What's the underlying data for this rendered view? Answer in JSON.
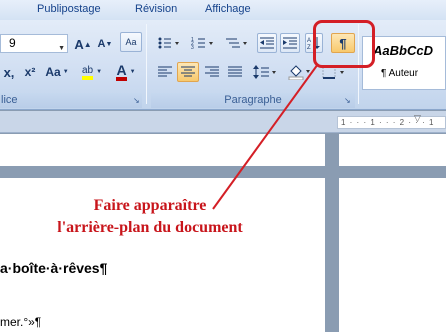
{
  "tabs": [
    "Publipostage",
    "Révision",
    "Affichage"
  ],
  "font": {
    "size_value": "9",
    "grow_label": "A",
    "shrink_label": "A",
    "clear_label": "Aa",
    "strike_label": "x,",
    "superscript_label": "x²",
    "case_label": "Aa",
    "highlight_label": "ab",
    "color_label": "A",
    "group_label": "lice"
  },
  "paragraph": {
    "group_label": "Paragraphe",
    "show_marks_label": "¶"
  },
  "styles": {
    "sample": "AaBbCcD",
    "name": "¶ Auteur"
  },
  "ruler": {
    "marks": "1 · · · 1 · · · 2 · · · 1"
  },
  "annotation": {
    "line1": "Faire apparaître",
    "line2": "l'arrière-plan du document"
  },
  "document": {
    "title_line": "a·boîte·à·rêves¶",
    "body_line": "mer.°»¶"
  },
  "colors": {
    "callout": "#d41f26",
    "annotation": "#c8151b",
    "highlight": "#ffff00",
    "font_color": "#c00000"
  }
}
